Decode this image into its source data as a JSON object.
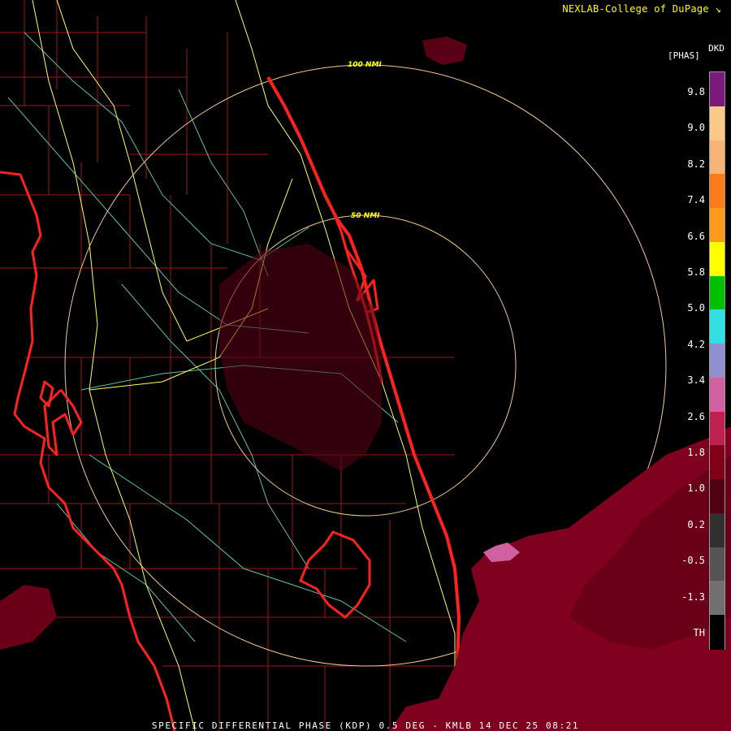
{
  "header": {
    "credit": "NEXLAB-College of DuPage",
    "credit_icon": "corner-arrow-icon",
    "product_code": "DKD",
    "units": "[PHAS]"
  },
  "range_rings": [
    {
      "label": "50 NMI"
    },
    {
      "label": "100 NMI"
    }
  ],
  "color_scale": {
    "ticks": [
      "9.8",
      "9.0",
      "8.2",
      "7.4",
      "6.6",
      "5.8",
      "5.0",
      "4.2",
      "3.4",
      "2.6",
      "1.8",
      "1.0",
      "0.2",
      "-0.5",
      "-1.3",
      "TH"
    ],
    "colors": [
      "#7a1a7a",
      "#f9c98a",
      "#f7b477",
      "#ff7a1a",
      "#ff9a1a",
      "#ffff00",
      "#00c000",
      "#30e0e0",
      "#9090d0",
      "#d060a0",
      "#c02050",
      "#800018",
      "#500010",
      "#303030",
      "#555555",
      "#707070",
      "#000000"
    ]
  },
  "footer": {
    "caption": "SPECIFIC DIFFERENTIAL PHASE (KDP) 0.5 DEG - KMLB 14 DEC 25 08:21"
  },
  "colors": {
    "coast": "#ff2020",
    "county": "#a01818",
    "highway_interstate": "#ffff60",
    "highway_us": "#60c0a0",
    "ring": "#f0c890",
    "echo": "#800020"
  }
}
